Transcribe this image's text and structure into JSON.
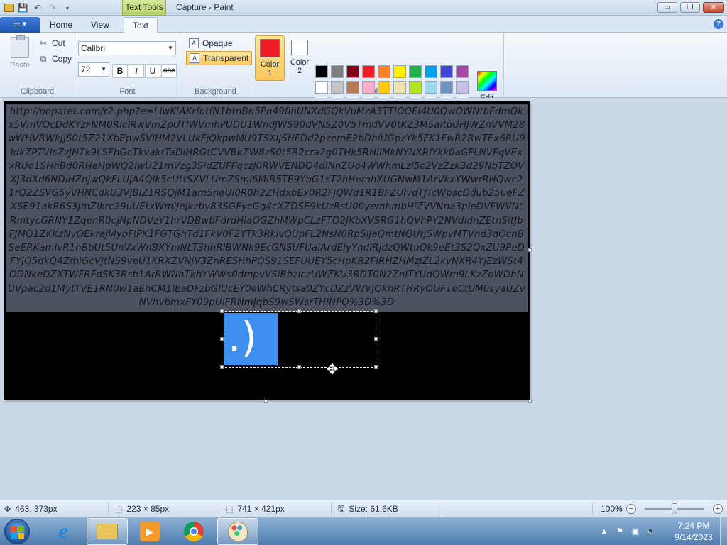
{
  "window": {
    "title": "Capture - Paint",
    "contextual_tab": "Text Tools",
    "minimize": "▭",
    "maximize": "❐",
    "close": "✕"
  },
  "tabs": [
    {
      "label": "Home"
    },
    {
      "label": "View"
    },
    {
      "label": "Text"
    }
  ],
  "ribbon": {
    "clipboard": {
      "label": "Clipboard",
      "paste": "Paste",
      "cut": "Cut",
      "copy": "Copy"
    },
    "font": {
      "label": "Font",
      "family": "Calibri",
      "size": "72",
      "bold": "B",
      "italic": "I",
      "underline": "U",
      "strike": "abc"
    },
    "background": {
      "label": "Background",
      "opaque": "Opaque",
      "transparent": "Transparent",
      "selected": "Transparent"
    },
    "colors": {
      "label": "Colors",
      "color1_label": "Color 1",
      "color2_label": "Color 2",
      "color1": "#ed1c24",
      "color2": "#ffffff",
      "edit_label": "Edit colors",
      "palette_row1": [
        "#000000",
        "#7f7f7f",
        "#880015",
        "#ed1c24",
        "#ff7f27",
        "#fff200",
        "#22b14c",
        "#00a2e8",
        "#3f48cc",
        "#a349a4"
      ],
      "palette_row2": [
        "#ffffff",
        "#c3c3c3",
        "#b97a57",
        "#ffaec9",
        "#ffc90e",
        "#efe4b0",
        "#b5e61d",
        "#99d9ea",
        "#7092be",
        "#c8bfe7"
      ]
    }
  },
  "canvas": {
    "url_text": "http://oopatet.com/r2.php?e=LlwKIAKrfotfN1btnBn5Pn49flhUNXdGQkVuMzA3TTlOOEI4U0QwOWNtbFdmQkx5VmVOcDdKYzFNM0RlclRwVmZpUTlWVmhPUDU1WndJWS90dVNSZ0V5TmdVV0tKZ3M5aitoUHJWZnVVM28wWHVRWkJjS0t5Z21XbEpwSVlHM2VLUkFjQkpwMU9TSXljSHFDd2pzemE2bDhiUGpzYk5FK1FwR2RwTEx6RU9ldkZPTVlsZzJHTk9LSFhGcTkvaktTaDlHRGtCVVBkZW8zS0t5R2cra2g0THk5RHllMkNYNXRlYkk0aGFLNVFqVExxRUo1SHhBd0RHeHpWQ2IwU21mVzg3SldZUFFqczJ0RWVENDQ4dlNnZUo4WWhmLzl5c2VzZzk3d29NbTZOVXJ3dXd6NDlHZnJwQkFLUjA4Qlk5cUttSXVLUmZSml6MlB5TE9YbG1sT2hHemhXUGNwM1ArVkxYWwrRHQwc21rQ2ZSVG5yVHNCdkU3VjBiZ1RSQjM1am5neUl0R0h2ZHdxbEx0R2FjQWd1R1BFZUlvdTJTcWpscDdub25ueFZXSE91akR6S3JmZlkrc29uUEtxWmlJejkzby83SGFycGg4cXZDSE9kUzRsU00yemhmbHlZVVNna3pleDVFWVNtRmtycGRNY1ZqenR0cjNpNDVzY1hrVDBwbFdrdHlaOGZhMWpCLzFTQ2JKbXVSRG1hQVhPY2NVdldnZEtnSitJbFJMQ1ZKKzNvOEkrajMybFlPK1FGTGhTd1FkV0F2YTk3RklvQUpFL2NsN0RpSlJaQmtNQUtjSWpvMTVnd3dOcnBSeERKamlvR1hBbUt5UnVxWnBXYmNLT3hhRlBWNk9EcGNSUFUalArdElyYndlRjdzQWtuQk9eEt3S2QxZU9PeDFYjQ5dkQ4ZmlGcVJtNS9veU1KRXZVNjV3ZnRESHhPQS91SEFUUEY5cHpKR2FlRHZHMzJZL2kvNXR4YjEzWSt4ODNkeDZXTWFRFdSK3Rsb1ArRWNhTkhYWWs0dmpvVSlBbzlczUWZKU3RDT0N2ZnlTYUdQWm9LKzZoWDhNUVpac2d1MytTVE1RN0w1aEhCM1lEaDFzbGlUcEY0eWhCRytsa0ZYcDZzVWVJQkhRTHRyOUF1eCtUM0syaUZvNVhvbmxFY09pUlFRNmJqbS9wSWsrTHlNPQ%3D%3D",
    "textbox_char": ".)",
    "selection_handles": 8
  },
  "statusbar": {
    "cursor_pos": "463, 373px",
    "selection_size": "223 × 85px",
    "canvas_size": "741 × 421px",
    "file_size": "Size: 61.6KB",
    "zoom": "100%"
  },
  "taskbar": {
    "apps": [
      {
        "name": "Internet Explorer",
        "icon": "ie-icon"
      },
      {
        "name": "File Explorer",
        "icon": "folder-icon"
      },
      {
        "name": "Media Player",
        "icon": "media-player-icon"
      },
      {
        "name": "Chrome",
        "icon": "chrome-icon"
      },
      {
        "name": "Paint",
        "icon": "paint-icon",
        "active": true
      }
    ],
    "time": "7:24 PM",
    "date": "9/14/2023"
  }
}
